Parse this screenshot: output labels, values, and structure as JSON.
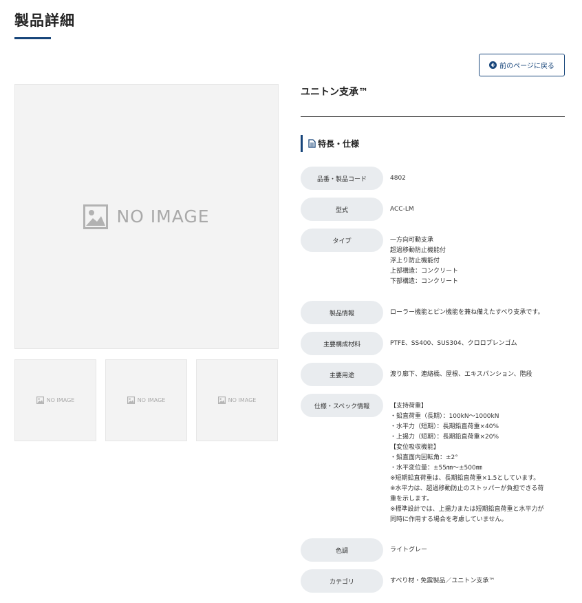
{
  "page": {
    "title": "製品詳細"
  },
  "back_button": {
    "label": "前のページに戻る",
    "icon": "arrow-circle-left-icon"
  },
  "gallery": {
    "placeholder_text": "NO IMAGE",
    "thumbnails": [
      "NO IMAGE",
      "NO IMAGE",
      "NO IMAGE"
    ]
  },
  "product": {
    "name": "ユニトン支承™"
  },
  "section": {
    "heading": "特長・仕様",
    "icon": "document-icon"
  },
  "specs": [
    {
      "label": "品番・製品コード",
      "lines": [
        "4802"
      ]
    },
    {
      "label": "型式",
      "lines": [
        "ACC-LM"
      ]
    },
    {
      "label": "タイプ",
      "lines": [
        "一方向可動支承",
        "超過移動防止機能付",
        "浮上り防止機能付",
        "上部構造：コンクリート",
        "下部構造：コンクリート"
      ]
    },
    {
      "label": "製品情報",
      "lines": [
        "ローラー機能とピン機能を兼ね備えたすべり支承です。"
      ]
    },
    {
      "label": "主要構成材料",
      "lines": [
        "PTFE、SS400、SUS304、クロロプレンゴム"
      ]
    },
    {
      "label": "主要用途",
      "lines": [
        "渡り廊下、連絡橋、屋根、エキスパンション、階段"
      ]
    },
    {
      "label": "仕様・スペック情報",
      "lines": [
        "【支持荷重】",
        "・鉛直荷重（長期）：100kN〜1000kN",
        "・水平力（短期）：長期鉛直荷重×40%",
        "・上揚力（短期）：長期鉛直荷重×20%",
        "【変位吸収機能】",
        "・鉛直面内回転角：±2°",
        "・水平変位量：±55㎜〜±500㎜",
        "※短期鉛直荷重は、長期鉛直荷重×1.5としています。",
        "※水平力は、超過移動防止のストッパーが負担できる荷",
        "重を示します。",
        "※標準設計では、上揚力または短期鉛直荷重と水平力が",
        "同時に作用する場合を考慮していません。"
      ]
    },
    {
      "label": "色調",
      "lines": [
        "ライトグレー"
      ]
    },
    {
      "label": "カテゴリ",
      "lines": [
        "すべり材・免震製品／ユニトン支承™"
      ]
    }
  ],
  "colors": {
    "accent": "#17457a",
    "label_bg": "#e9ecef",
    "placeholder_bg": "#f3f3f3",
    "placeholder_text": "#a9a9a9"
  }
}
